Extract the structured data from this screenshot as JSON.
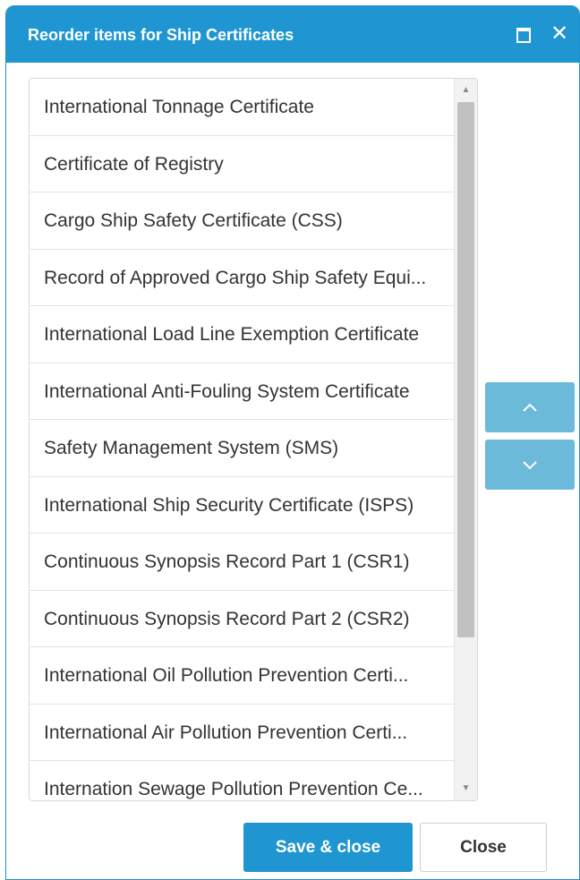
{
  "dialog": {
    "title": "Reorder items for Ship Certificates",
    "maximize_icon": "maximize-icon",
    "close_icon": "close-icon",
    "close_glyph": "✕"
  },
  "list": {
    "items": [
      "International Tonnage Certificate",
      "Certificate of Registry",
      "Cargo Ship Safety Certificate (CSS)",
      "Record of Approved Cargo Ship Safety Equi...",
      "International Load Line Exemption Certificate",
      "International Anti-Fouling System Certificate",
      "Safety Management System (SMS)",
      "International Ship Security Certificate (ISPS)",
      "Continuous Synopsis Record Part 1 (CSR1)",
      "Continuous Synopsis Record Part 2 (CSR2)",
      "International Oil Pollution Prevention Certi...",
      "International Air Pollution Prevention Certi...",
      "Internation Sewage Pollution Prevention Ce..."
    ],
    "scroll_up_glyph": "▲",
    "scroll_down_glyph": "▼"
  },
  "reorder": {
    "up_icon": "chevron-up-icon",
    "down_icon": "chevron-down-icon"
  },
  "footer": {
    "save_label": "Save & close",
    "close_label": "Close"
  },
  "colors": {
    "accent": "#1f96d1",
    "reorder_button": "#6bbad9",
    "scroll_thumb": "#c1c1c1"
  }
}
